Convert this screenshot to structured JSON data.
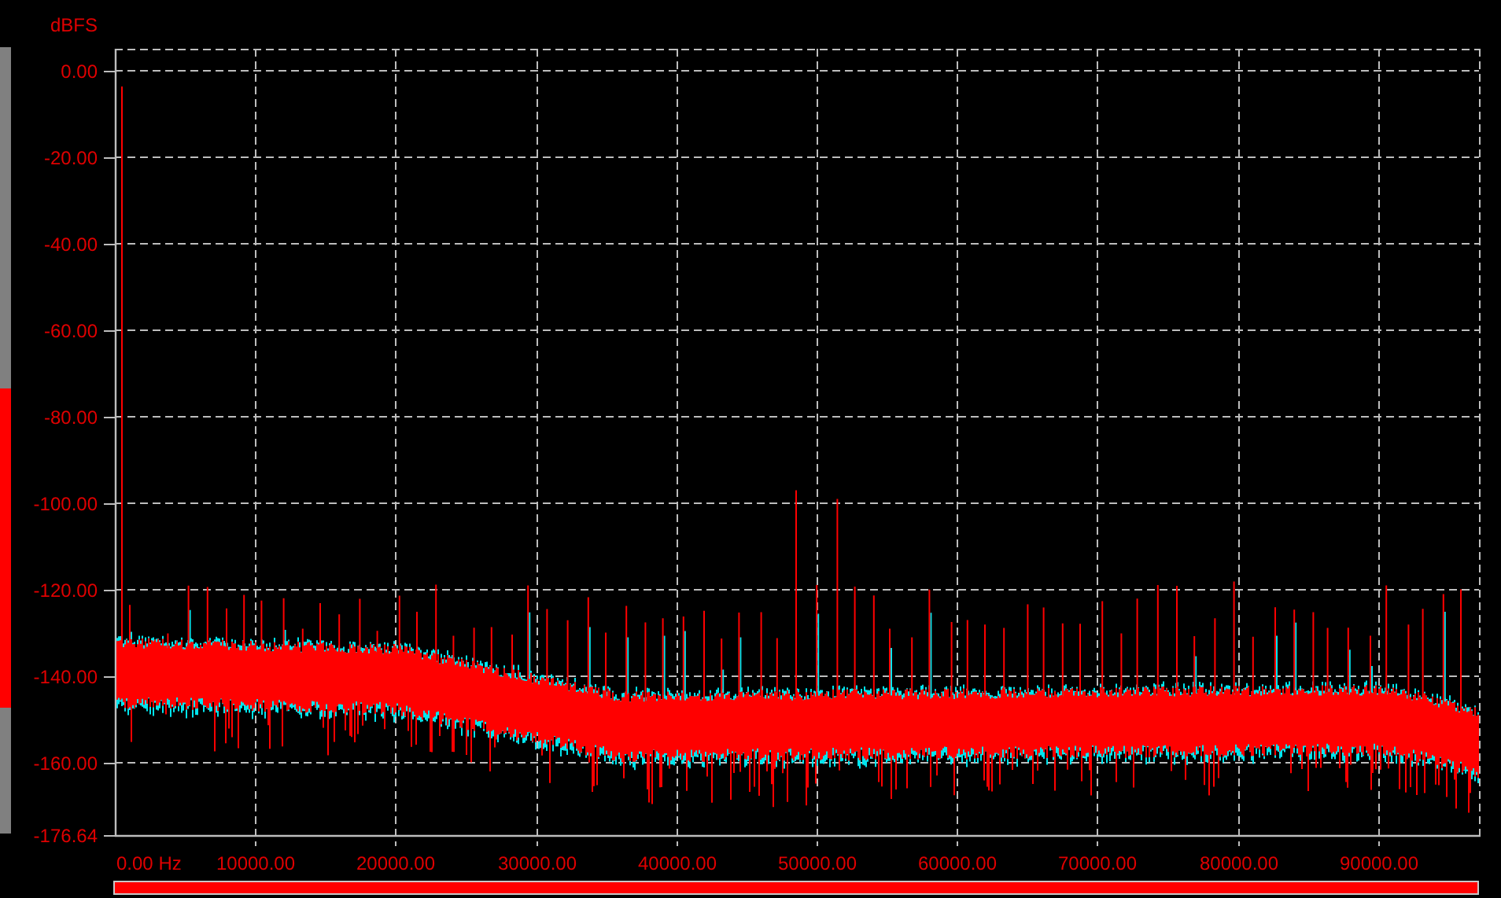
{
  "plot": {
    "y_unit": "dBFS",
    "yticks": [
      "0.00",
      "-20.00",
      "-40.00",
      "-60.00",
      "-80.00",
      "-100.00",
      "-120.00",
      "-140.00",
      "-160.00",
      "-176.64"
    ],
    "xticks": [
      "0.00 Hz",
      "10000.00",
      "20000.00",
      "30000.00",
      "40000.00",
      "50000.00",
      "60000.00",
      "70000.00",
      "80000.00",
      "90000.00"
    ]
  }
}
